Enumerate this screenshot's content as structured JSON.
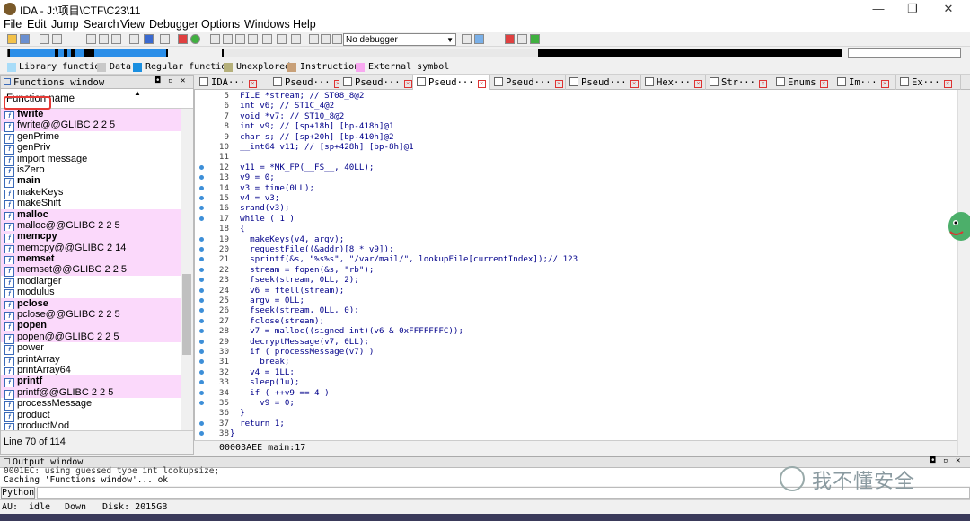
{
  "window": {
    "title": "IDA - J:\\项目\\CTF\\C23\\11",
    "minimize": "—",
    "maximize": "❐",
    "close": "✕"
  },
  "menu": [
    "File",
    "Edit",
    "Jump",
    "Search",
    "View",
    "Debugger",
    "Options",
    "Windows",
    "Help"
  ],
  "toolbar": {
    "debugger_select": "No debugger"
  },
  "legend": [
    {
      "label": "Library function",
      "color": "#a8dcf8"
    },
    {
      "label": "Data",
      "color": "#c8c8c8"
    },
    {
      "label": "Regular function",
      "color": "#1a8fe0"
    },
    {
      "label": "Unexplored",
      "color": "#b5b07a"
    },
    {
      "label": "Instruction",
      "color": "#c8a078"
    },
    {
      "label": "External symbol",
      "color": "#f8a8f0"
    }
  ],
  "functions_window": {
    "title": "Functions window",
    "column_header": "Function name",
    "items": [
      {
        "name": "fwrite",
        "bold": true,
        "lib": true
      },
      {
        "name": "fwrite@@GLIBC 2 2 5",
        "bold": false,
        "lib": true
      },
      {
        "name": "genPrime",
        "bold": false,
        "lib": false
      },
      {
        "name": "genPriv",
        "bold": false,
        "lib": false
      },
      {
        "name": "import message",
        "bold": false,
        "lib": false
      },
      {
        "name": "isZero",
        "bold": false,
        "lib": false
      },
      {
        "name": "main",
        "bold": true,
        "lib": false
      },
      {
        "name": "makeKeys",
        "bold": false,
        "lib": false
      },
      {
        "name": "makeShift",
        "bold": false,
        "lib": false
      },
      {
        "name": "malloc",
        "bold": true,
        "lib": true
      },
      {
        "name": "malloc@@GLIBC 2 2 5",
        "bold": false,
        "lib": true
      },
      {
        "name": "memcpy",
        "bold": true,
        "lib": true
      },
      {
        "name": "memcpy@@GLIBC 2 14",
        "bold": false,
        "lib": true
      },
      {
        "name": "memset",
        "bold": true,
        "lib": true
      },
      {
        "name": "memset@@GLIBC 2 2 5",
        "bold": false,
        "lib": true
      },
      {
        "name": "modlarger",
        "bold": false,
        "lib": false
      },
      {
        "name": "modulus",
        "bold": false,
        "lib": false
      },
      {
        "name": "pclose",
        "bold": true,
        "lib": true
      },
      {
        "name": "pclose@@GLIBC 2 2 5",
        "bold": false,
        "lib": true
      },
      {
        "name": "popen",
        "bold": true,
        "lib": true
      },
      {
        "name": "popen@@GLIBC 2 2 5",
        "bold": false,
        "lib": true
      },
      {
        "name": "power",
        "bold": false,
        "lib": false
      },
      {
        "name": "printArray",
        "bold": false,
        "lib": false
      },
      {
        "name": "printArray64",
        "bold": false,
        "lib": false
      },
      {
        "name": "printf",
        "bold": true,
        "lib": true
      },
      {
        "name": "printf@@GLIBC 2 2 5",
        "bold": false,
        "lib": true
      },
      {
        "name": "processMessage",
        "bold": false,
        "lib": false
      },
      {
        "name": "product",
        "bold": false,
        "lib": false
      },
      {
        "name": "productMod",
        "bold": false,
        "lib": false
      }
    ],
    "status": "Line 70 of 114"
  },
  "tabs": [
    {
      "label": "IDA···",
      "active": false
    },
    {
      "label": "Pseud···",
      "active": false
    },
    {
      "label": "Pseud···",
      "active": false
    },
    {
      "label": "Pseud···",
      "active": true
    },
    {
      "label": "Pseud···",
      "active": false
    },
    {
      "label": "Pseud···",
      "active": false
    },
    {
      "label": "Hex···",
      "active": false
    },
    {
      "label": "Str···",
      "active": false
    },
    {
      "label": "Enums",
      "active": false
    },
    {
      "label": "Im···",
      "active": false
    },
    {
      "label": "Ex···",
      "active": false
    }
  ],
  "code": [
    {
      "n": "5",
      "t": "  FILE *stream; // ST08_8@2",
      "dot": false
    },
    {
      "n": "6",
      "t": "  int v6; // ST1C_4@2",
      "dot": false
    },
    {
      "n": "7",
      "t": "  void *v7; // ST10_8@2",
      "dot": false
    },
    {
      "n": "8",
      "t": "  int v9; // [sp+18h] [bp-418h]@1",
      "dot": false
    },
    {
      "n": "9",
      "t": "  char s; // [sp+20h] [bp-410h]@2",
      "dot": false
    },
    {
      "n": "10",
      "t": "  __int64 v11; // [sp+428h] [bp-8h]@1",
      "dot": false
    },
    {
      "n": "11",
      "t": "",
      "dot": false
    },
    {
      "n": "12",
      "t": "  v11 = *MK_FP(__FS__, 40LL);",
      "dot": true
    },
    {
      "n": "13",
      "t": "  v9 = 0;",
      "dot": true
    },
    {
      "n": "14",
      "t": "  v3 = time(0LL);",
      "dot": true
    },
    {
      "n": "15",
      "t": "  v4 = v3;",
      "dot": true
    },
    {
      "n": "16",
      "t": "  srand(v3);",
      "dot": true
    },
    {
      "n": "17",
      "t": "  while ( 1 )",
      "dot": true
    },
    {
      "n": "18",
      "t": "  {",
      "dot": false
    },
    {
      "n": "19",
      "t": "    makeKeys(v4, argv);",
      "dot": true
    },
    {
      "n": "20",
      "t": "    requestFile((&addr)[8 * v9]);",
      "dot": true
    },
    {
      "n": "21",
      "t": "    sprintf(&s, \"%s%s\", \"/var/mail/\", lookupFile[currentIndex]);// 123",
      "dot": true
    },
    {
      "n": "22",
      "t": "    stream = fopen(&s, \"rb\");",
      "dot": true
    },
    {
      "n": "23",
      "t": "    fseek(stream, 0LL, 2);",
      "dot": true
    },
    {
      "n": "24",
      "t": "    v6 = ftell(stream);",
      "dot": true
    },
    {
      "n": "25",
      "t": "    argv = 0LL;",
      "dot": true
    },
    {
      "n": "26",
      "t": "    fseek(stream, 0LL, 0);",
      "dot": true
    },
    {
      "n": "27",
      "t": "    fclose(stream);",
      "dot": true
    },
    {
      "n": "28",
      "t": "    v7 = malloc((signed int)(v6 & 0xFFFFFFFC));",
      "dot": true
    },
    {
      "n": "29",
      "t": "    decryptMessage(v7, 0LL);",
      "dot": true
    },
    {
      "n": "30",
      "t": "    if ( processMessage(v7) )",
      "dot": true
    },
    {
      "n": "31",
      "t": "      break;",
      "dot": true
    },
    {
      "n": "32",
      "t": "    v4 = 1LL;",
      "dot": true
    },
    {
      "n": "33",
      "t": "    sleep(1u);",
      "dot": true
    },
    {
      "n": "34",
      "t": "    if ( ++v9 == 4 )",
      "dot": true
    },
    {
      "n": "35",
      "t": "      v9 = 0;",
      "dot": true
    },
    {
      "n": "36",
      "t": "  }",
      "dot": false
    },
    {
      "n": "37",
      "t": "  return 1;",
      "dot": true
    },
    {
      "n": "38",
      "t": "}",
      "dot": true
    }
  ],
  "code_status": "00003AEE main:17",
  "output": {
    "title": "Output window",
    "lines": [
      "0001EC: using guessed type int lookupsize;",
      "Caching 'Functions window'... ok"
    ],
    "python_label": "Python"
  },
  "status": {
    "au": "AU:",
    "state": "idle",
    "dir": "Down",
    "disk": "Disk: 2015GB"
  },
  "watermark": "我不懂安全"
}
